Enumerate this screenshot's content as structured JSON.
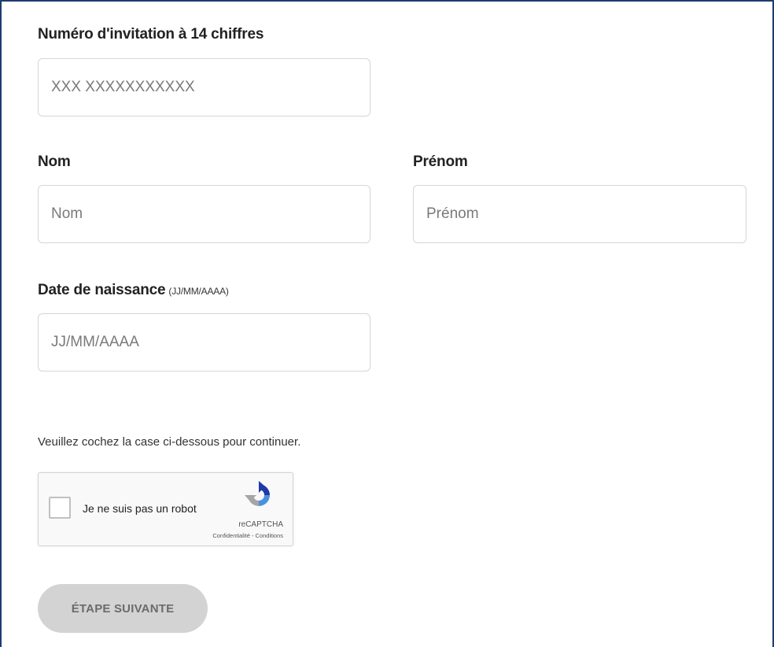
{
  "invitation": {
    "label": "Numéro d'invitation à 14 chiffres",
    "placeholder": "XXX XXXXXXXXXXX",
    "value": ""
  },
  "last_name": {
    "label": "Nom",
    "placeholder": "Nom",
    "value": ""
  },
  "first_name": {
    "label": "Prénom",
    "placeholder": "Prénom",
    "value": ""
  },
  "birth_date": {
    "label": "Date de naissance",
    "hint": "(JJ/MM/AAAA)",
    "placeholder": "JJ/MM/AAAA",
    "value": ""
  },
  "captcha": {
    "notice": "Veuillez cochez la case ci-dessous pour continuer.",
    "checkbox_label": "Je ne suis pas un robot",
    "brand": "reCAPTCHA",
    "privacy_link": "Confidentialité",
    "separator": " - ",
    "terms_link": "Conditions"
  },
  "next_button": {
    "label": "ÉTAPE SUIVANTE",
    "enabled": false
  },
  "colors": {
    "frame_border": "#1d3d6e",
    "button_disabled_bg": "#d3d3d3",
    "button_disabled_text": "#6b6b6b",
    "recaptcha_blue": "#1c3aa9",
    "recaptcha_light_blue": "#4a90e2",
    "recaptcha_grey": "#a6a6a6"
  }
}
